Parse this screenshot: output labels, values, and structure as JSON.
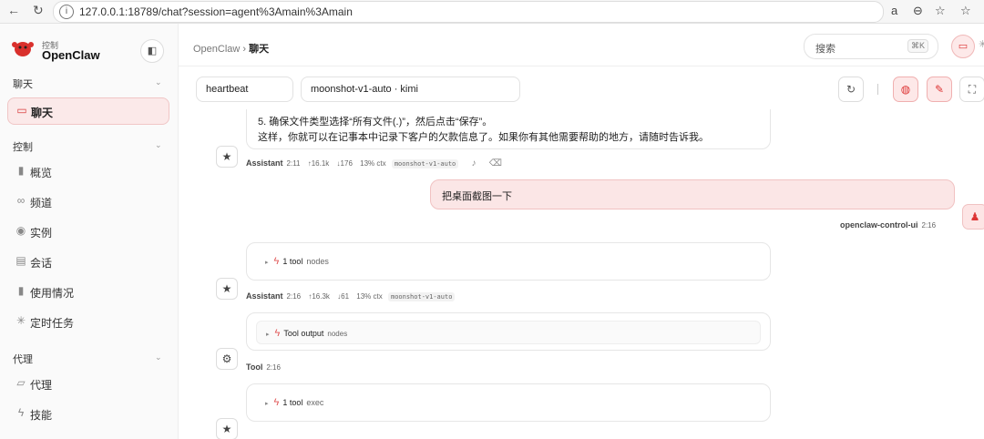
{
  "browser": {
    "url": "127.0.0.1:18789/chat?session=agent%3Amain%3Amain"
  },
  "sidebar": {
    "brand_small": "控制",
    "brand": "OpenClaw",
    "sections": [
      {
        "title": "聊天",
        "items": [
          {
            "label": "聊天",
            "icon": "chat-bubble-icon",
            "active": true
          }
        ]
      },
      {
        "title": "控制",
        "items": [
          {
            "label": "概览",
            "icon": "bar-chart-icon"
          },
          {
            "label": "频道",
            "icon": "link-icon"
          },
          {
            "label": "实例",
            "icon": "broadcast-icon"
          },
          {
            "label": "会话",
            "icon": "document-icon"
          },
          {
            "label": "使用情况",
            "icon": "bar-chart-icon"
          },
          {
            "label": "定时任务",
            "icon": "loader-icon"
          }
        ]
      },
      {
        "title": "代理",
        "items": [
          {
            "label": "代理",
            "icon": "folder-icon"
          },
          {
            "label": "技能",
            "icon": "bolt-icon"
          }
        ]
      }
    ]
  },
  "header": {
    "breadcrumb_root": "OpenClaw",
    "breadcrumb_sep": "›",
    "breadcrumb_current": "聊天",
    "search_placeholder": "搜索",
    "search_shortcut": "⌘K"
  },
  "toolbar": {
    "session": "heartbeat",
    "model": "moonshot-v1-auto · kimi"
  },
  "messages": [
    {
      "lines": [
        "5. 确保文件类型选择“所有文件(.)”，然后点击“保存”。",
        "这样，你就可以在记事本中记录下客户的欠款信息了。如果你有其他需要帮助的地方，请随时告诉我。"
      ],
      "role": "Assistant",
      "time": "2:11",
      "tokens_in": "↑16.1k",
      "tokens_out": "↓176",
      "ctx": "13% ctx",
      "model": "moonshot-v1-auto"
    },
    {
      "user_text": "把桌面截图一下",
      "sender": "openclaw-control-ui",
      "time": "2:16"
    },
    {
      "tool_label": "1 tool",
      "tool_name": "nodes",
      "role": "Assistant",
      "time": "2:16",
      "tokens_in": "↑16.3k",
      "tokens_out": "↓61",
      "ctx": "13% ctx",
      "model": "moonshot-v1-auto"
    },
    {
      "tool_label": "Tool output",
      "tool_name": "nodes",
      "role": "Tool",
      "time": "2:16"
    },
    {
      "tool_label": "1 tool",
      "tool_name": "exec"
    }
  ]
}
